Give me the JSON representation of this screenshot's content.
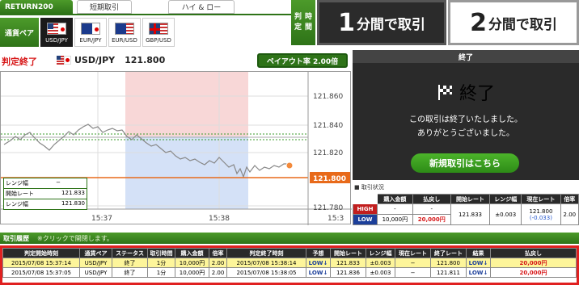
{
  "tabs": {
    "active": "RETURN200",
    "short": "短期取引",
    "highlow": "ハイ & ロー"
  },
  "pairs": {
    "label": "通貨ペア",
    "items": [
      {
        "label": "USD/JPY",
        "active": true
      },
      {
        "label": "EUR/JPY",
        "active": false
      },
      {
        "label": "EUR/USD",
        "active": false
      },
      {
        "label": "GBP/USD",
        "active": false
      }
    ]
  },
  "time": {
    "label1": "判定",
    "label2": "時間",
    "btn1_num": "1",
    "btn1_txt": "分間で取引",
    "btn2_num": "2",
    "btn2_txt": "分間で取引"
  },
  "chart_header": {
    "status": "判定終了",
    "pair": "USD/JPY",
    "price": "121.800",
    "payout": "ペイアウト率 2.00倍"
  },
  "chart_data": {
    "type": "line",
    "yticks": [
      "121.860",
      "121.840",
      "121.820",
      "121.800",
      "121.780"
    ],
    "xticks": [
      "15:37",
      "15:38",
      "15:3"
    ],
    "current": "121.800",
    "info": [
      {
        "label": "レンジ幅",
        "value": "−"
      },
      {
        "label": "開始レート",
        "value": "121.833"
      },
      {
        "label": "レンジ幅",
        "value": "121.830"
      }
    ]
  },
  "right_panel": {
    "header": "終了",
    "title": "終了",
    "msg1": "この取引は終了いたしました。",
    "msg2": "ありがとうございました。",
    "new_trade": "新規取引はこちら",
    "status_label": "取引状況",
    "table": {
      "headers": [
        "購入金額",
        "払戻し",
        "開始レート",
        "レンジ幅",
        "現在レート",
        "倍率"
      ],
      "high": {
        "label": "HIGH",
        "amount": "-",
        "payout": "-"
      },
      "low": {
        "label": "LOW",
        "amount": "10,000円",
        "payout": "20,000円"
      },
      "start_rate": "121.833",
      "range": "±0.003",
      "current_rate": "121.800",
      "diff": "(-0.033)",
      "mult": "2.00"
    }
  },
  "history": {
    "title": "取引履歴",
    "hint": "※クリックで開閉します。",
    "headers": [
      "判定開始時刻",
      "通貨ペア",
      "ステータス",
      "取引時間",
      "購入金額",
      "倍率",
      "判定終了時刻",
      "予想",
      "開始レート",
      "レンジ幅",
      "現在レート",
      "終了レート",
      "結果",
      "払戻し"
    ],
    "rows": [
      [
        "2015/07/08 15:37:14",
        "USD/JPY",
        "終了",
        "1分",
        "10,000円",
        "2.00",
        "2015/07/08 15:38:14",
        "LOW↓",
        "121.833",
        "±0.003",
        "−",
        "121.800",
        "LOW↓",
        "20,000円"
      ],
      [
        "2015/07/08 15:37:05",
        "USD/JPY",
        "終了",
        "1分",
        "10,000円",
        "2.00",
        "2015/07/08 15:38:05",
        "LOW↓",
        "121.836",
        "±0.003",
        "−",
        "121.811",
        "LOW↓",
        "20,000円"
      ]
    ]
  }
}
